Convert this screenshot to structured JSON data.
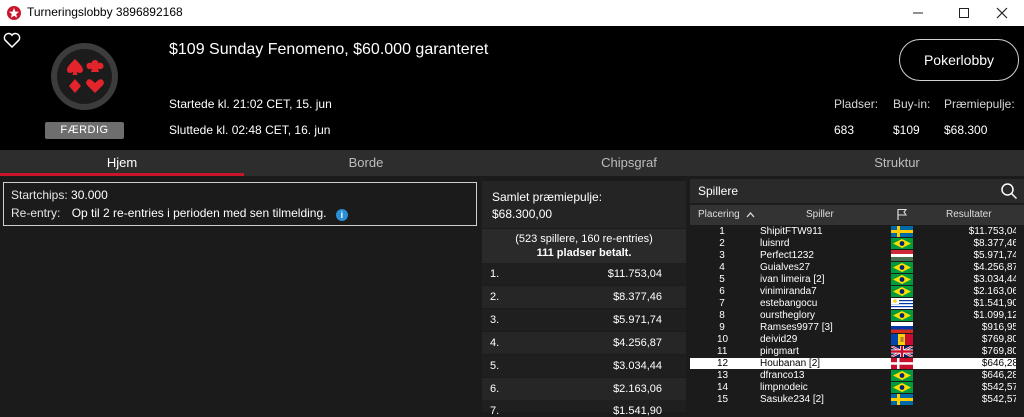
{
  "window": {
    "title": "Turneringslobby 3896892168",
    "controls": [
      "minimize-icon",
      "maximize-icon",
      "close-icon"
    ]
  },
  "header": {
    "tournament_name": "$109 Sunday Fenomeno, $60.000 garanteret",
    "status_badge": "FÆRDIG",
    "started": "Startede kl. 21:02 CET, 15. jun",
    "ended": "Sluttede kl. 02:48 CET, 16. jun",
    "lobby_button": "Pokerlobby",
    "stats": [
      {
        "label": "Pladser:",
        "value": "683"
      },
      {
        "label": "Buy-in:",
        "value": "$109"
      },
      {
        "label": "Præmiepulje:",
        "value": "$68.300"
      }
    ]
  },
  "tabs": [
    "Hjem",
    "Borde",
    "Chipsgraf",
    "Struktur"
  ],
  "active_tab": "Hjem",
  "info": {
    "startchips_label": "Startchips:",
    "startchips_value": "30.000",
    "reentry_label": "Re-entry:",
    "reentry_value": "Op til 2 re-entries i perioden med sen tilmelding.",
    "info_icon_text": "i"
  },
  "prize": {
    "title": "Samlet præmiepulje:",
    "total": "$68.300,00",
    "note_line1": "(523 spillere, 160 re-entries)",
    "note_line2": "111 pladser betalt.",
    "rows": [
      {
        "rank": "1.",
        "amount": "$11.753,04"
      },
      {
        "rank": "2.",
        "amount": "$8.377,46"
      },
      {
        "rank": "3.",
        "amount": "$5.971,74"
      },
      {
        "rank": "4.",
        "amount": "$4.256,87"
      },
      {
        "rank": "5.",
        "amount": "$3.034,44"
      },
      {
        "rank": "6.",
        "amount": "$2.163,06"
      },
      {
        "rank": "7.",
        "amount": "$1.541,90"
      }
    ]
  },
  "players": {
    "title": "Spillere",
    "columns": {
      "place": "Placering",
      "player": "Spiller",
      "result": "Resultater"
    },
    "rows": [
      {
        "rank": "1",
        "name": "ShipitFTW911",
        "flag": "sweden",
        "result": "$11.753,04"
      },
      {
        "rank": "2",
        "name": "luisnrd",
        "flag": "brazil",
        "result": "$8.377,46"
      },
      {
        "rank": "3",
        "name": "Perfect1232",
        "flag": "hungary",
        "result": "$5.971,74"
      },
      {
        "rank": "4",
        "name": "Guialves27",
        "flag": "brazil",
        "result": "$4.256,87"
      },
      {
        "rank": "5",
        "name": "ivan limeira [2]",
        "flag": "brazil",
        "result": "$3.034,44"
      },
      {
        "rank": "6",
        "name": "vinimiranda7",
        "flag": "brazil",
        "result": "$2.163,06"
      },
      {
        "rank": "7",
        "name": "estebangocu",
        "flag": "uruguay",
        "result": "$1.541,90"
      },
      {
        "rank": "8",
        "name": "oursthеglory",
        "flag": "brazil",
        "result": "$1.099,12"
      },
      {
        "rank": "9",
        "name": "Ramses9977 [3]",
        "flag": "russia",
        "result": "$916,95"
      },
      {
        "rank": "10",
        "name": "deivid29",
        "flag": "moldova",
        "result": "$769,80"
      },
      {
        "rank": "11",
        "name": "pingmart",
        "flag": "uk",
        "result": "$769,80"
      },
      {
        "rank": "12",
        "name": "Houbanan [2]",
        "flag": "denmark",
        "result": "$646,28"
      },
      {
        "rank": "13",
        "name": "dfranco13",
        "flag": "brazil",
        "result": "$646,28"
      },
      {
        "rank": "14",
        "name": "limpnodeic",
        "flag": "brazil",
        "result": "$542,57"
      },
      {
        "rank": "15",
        "name": "Sasuke234 [2]",
        "flag": "sweden",
        "result": "$542,57"
      }
    ],
    "highlight_rank": "12"
  },
  "colors": {
    "accent": "#c9162b",
    "background": "#1b1b1b",
    "header_bg": "#000000"
  }
}
